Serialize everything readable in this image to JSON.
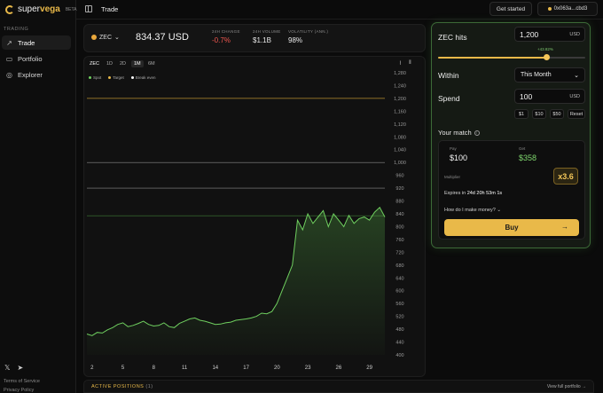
{
  "app": {
    "name_pre": "super",
    "name_bold": "vega",
    "badge": "BETA"
  },
  "topbar": {
    "title": "Trade",
    "get_started": "Get started",
    "wallet": "0x063a...cbd3"
  },
  "sidebar": {
    "section": "TRADING",
    "items": [
      {
        "label": "Trade",
        "icon": "trend-icon"
      },
      {
        "label": "Portfolio",
        "icon": "wallet-icon"
      },
      {
        "label": "Explorer",
        "icon": "globe-icon"
      }
    ],
    "footer": [
      "Terms of Service",
      "Privacy Policy"
    ]
  },
  "market": {
    "coin": "ZEC",
    "price": "834.37 USD",
    "stats": [
      {
        "label": "24H CHANGE",
        "value": "-0.7%"
      },
      {
        "label": "24H VOLUME",
        "value": "$1.1B"
      },
      {
        "label": "VOLATILITY (ANN.)",
        "value": "98%"
      }
    ]
  },
  "chart_controls": {
    "asset": "ZEC",
    "timeframes": [
      "1D",
      "2D",
      "1M",
      "6M"
    ],
    "active_timeframe": "1M",
    "legend": [
      {
        "name": "Spot",
        "color": "#6fcf5f"
      },
      {
        "name": "Target",
        "color": "#e9b949"
      },
      {
        "name": "Break even",
        "color": "#ffffff"
      }
    ]
  },
  "chart_data": {
    "type": "line",
    "x_ticks": [
      "2",
      "5",
      "8",
      "11",
      "14",
      "17",
      "20",
      "23",
      "26",
      "29"
    ],
    "y_ticks": [
      "1,280",
      "1,240",
      "1,200",
      "1,160",
      "1,120",
      "1,080",
      "1,040",
      "1,000",
      "960",
      "920",
      "880",
      "840",
      "800",
      "760",
      "720",
      "680",
      "640",
      "600",
      "560",
      "520",
      "480",
      "440",
      "400"
    ],
    "ylim": [
      400,
      1280
    ],
    "xlim": [
      1.5,
      30.5
    ],
    "target_line": 1200,
    "break_even_lines": [
      1000,
      920
    ],
    "spot_line": 834,
    "series": [
      {
        "x": [
          1.5,
          2,
          2.5,
          3,
          3.5,
          4,
          4.5,
          5,
          5.5,
          6,
          6.5,
          7,
          7.5,
          8,
          8.5,
          9,
          9.5,
          10,
          10.5,
          11,
          11.5,
          12,
          12.5,
          13,
          13.5,
          14,
          14.5,
          15,
          15.5,
          16,
          16.5,
          17,
          17.5,
          18,
          18.5,
          19,
          19.5,
          20,
          20.5,
          21,
          21.5,
          22,
          22.5,
          23,
          23.5,
          24,
          24.5,
          25,
          25.5,
          26,
          26.5,
          27,
          27.5,
          28,
          28.5,
          29,
          29.5,
          30,
          30.5
        ],
        "values": [
          465,
          460,
          470,
          468,
          478,
          485,
          495,
          500,
          488,
          492,
          498,
          505,
          495,
          490,
          492,
          500,
          488,
          485,
          498,
          505,
          512,
          515,
          508,
          505,
          500,
          495,
          496,
          500,
          502,
          508,
          510,
          512,
          515,
          520,
          530,
          528,
          535,
          560,
          600,
          640,
          680,
          820,
          790,
          840,
          810,
          830,
          850,
          800,
          840,
          820,
          800,
          835,
          810,
          825,
          830,
          820,
          845,
          860,
          830
        ]
      }
    ]
  },
  "trade_panel": {
    "zec_hits_label": "ZEC hits",
    "target_value": "1,200",
    "target_unit": "USD",
    "slider_pct": "+43.82%",
    "slider_fraction": 0.74,
    "within_label": "Within",
    "within_value": "This Month",
    "spend_label": "Spend",
    "spend_value": "100",
    "spend_unit": "USD",
    "quick_amounts": [
      "$1",
      "$10",
      "$50",
      "Reset"
    ],
    "match_title": "Your match",
    "pay_label": "Pay",
    "pay_value": "$100",
    "get_label": "Get",
    "get_value": "$358",
    "multiplier_label": "Multiplier",
    "multiplier_value": "x3.6",
    "expires_label": "Expires in",
    "expires_value": "24d 20h 53m 1s",
    "how_label": "How do I make money?",
    "buy_label": "Buy"
  },
  "positions": {
    "title": "ACTIVE POSITIONS",
    "count": "(1)",
    "link": "View full portfolio →"
  }
}
